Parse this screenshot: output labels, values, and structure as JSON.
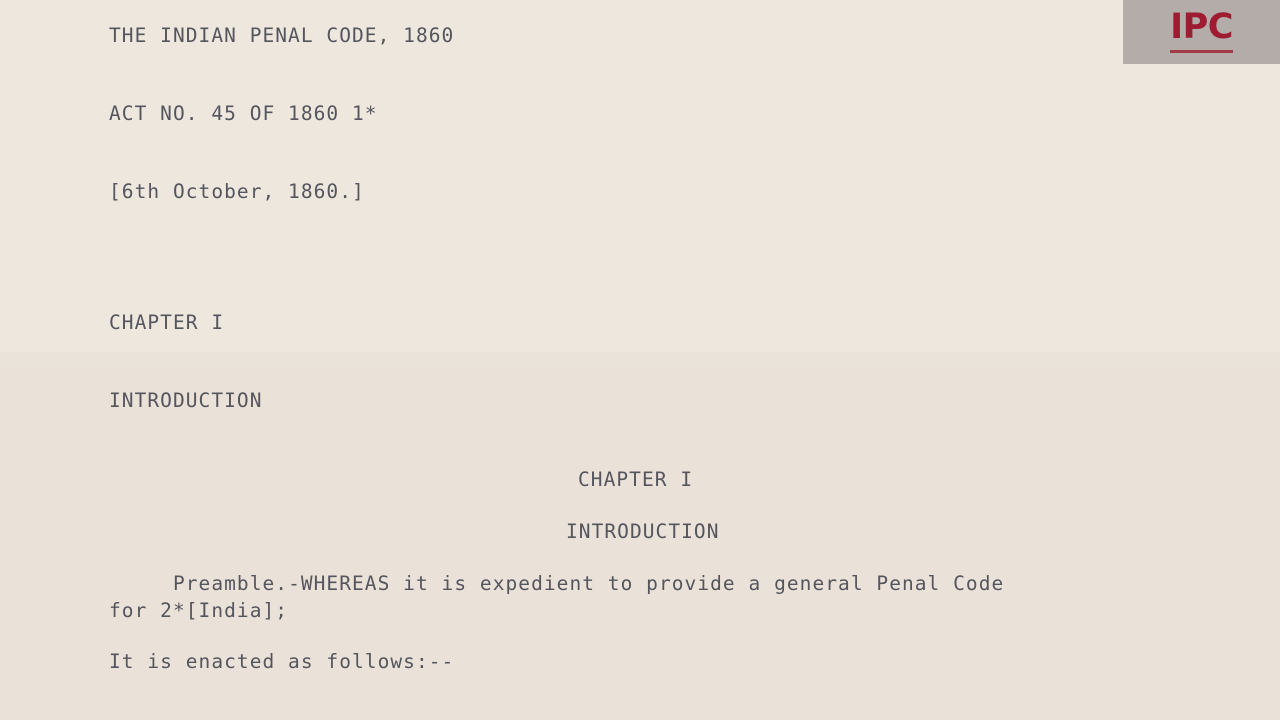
{
  "document": {
    "title_line": "THE INDIAN PENAL CODE, 1860",
    "act_line": "ACT NO. 45 OF 1860 1*",
    "date_line": "[6th October, 1860.]",
    "chapter_heading_left": "CHAPTER I",
    "section_heading_left": "INTRODUCTION",
    "chapter_heading_centered": "CHAPTER I",
    "section_heading_centered": "INTRODUCTION",
    "preamble_paragraph": "     Preamble.-WHEREAS it is expedient to provide a general Penal Code\nfor 2*[India];",
    "enactment_line": "It is enacted as follows:--"
  },
  "watermark": {
    "label": "IPC",
    "text_color": "#9e1b32",
    "background_color": "#b3aca8",
    "underline_color": "#a33a48"
  },
  "theme": {
    "page_background": "#ece5dd",
    "body_text_color": "#55555e"
  }
}
